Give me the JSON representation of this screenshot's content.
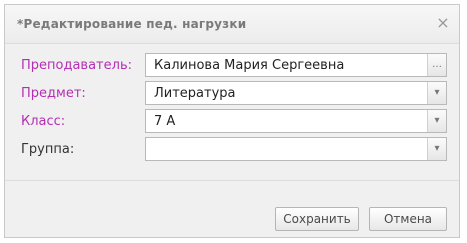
{
  "dialog": {
    "title": "*Редактирование пед. нагрузки",
    "close_glyph": "×"
  },
  "form": {
    "rows": [
      {
        "label": "Преподаватель:",
        "value": "Калинова Мария Сергеевна",
        "required": true,
        "control": "lookup",
        "button_glyph": "…"
      },
      {
        "label": "Предмет:",
        "value": "Литература",
        "required": true,
        "control": "select",
        "button_glyph": "▾"
      },
      {
        "label": "Класс:",
        "value": "7 А",
        "required": true,
        "control": "select",
        "button_glyph": "▾"
      },
      {
        "label": "Группа:",
        "value": "",
        "required": false,
        "control": "select",
        "button_glyph": "▾"
      }
    ]
  },
  "buttons": {
    "save": "Сохранить",
    "cancel": "Отмена"
  }
}
